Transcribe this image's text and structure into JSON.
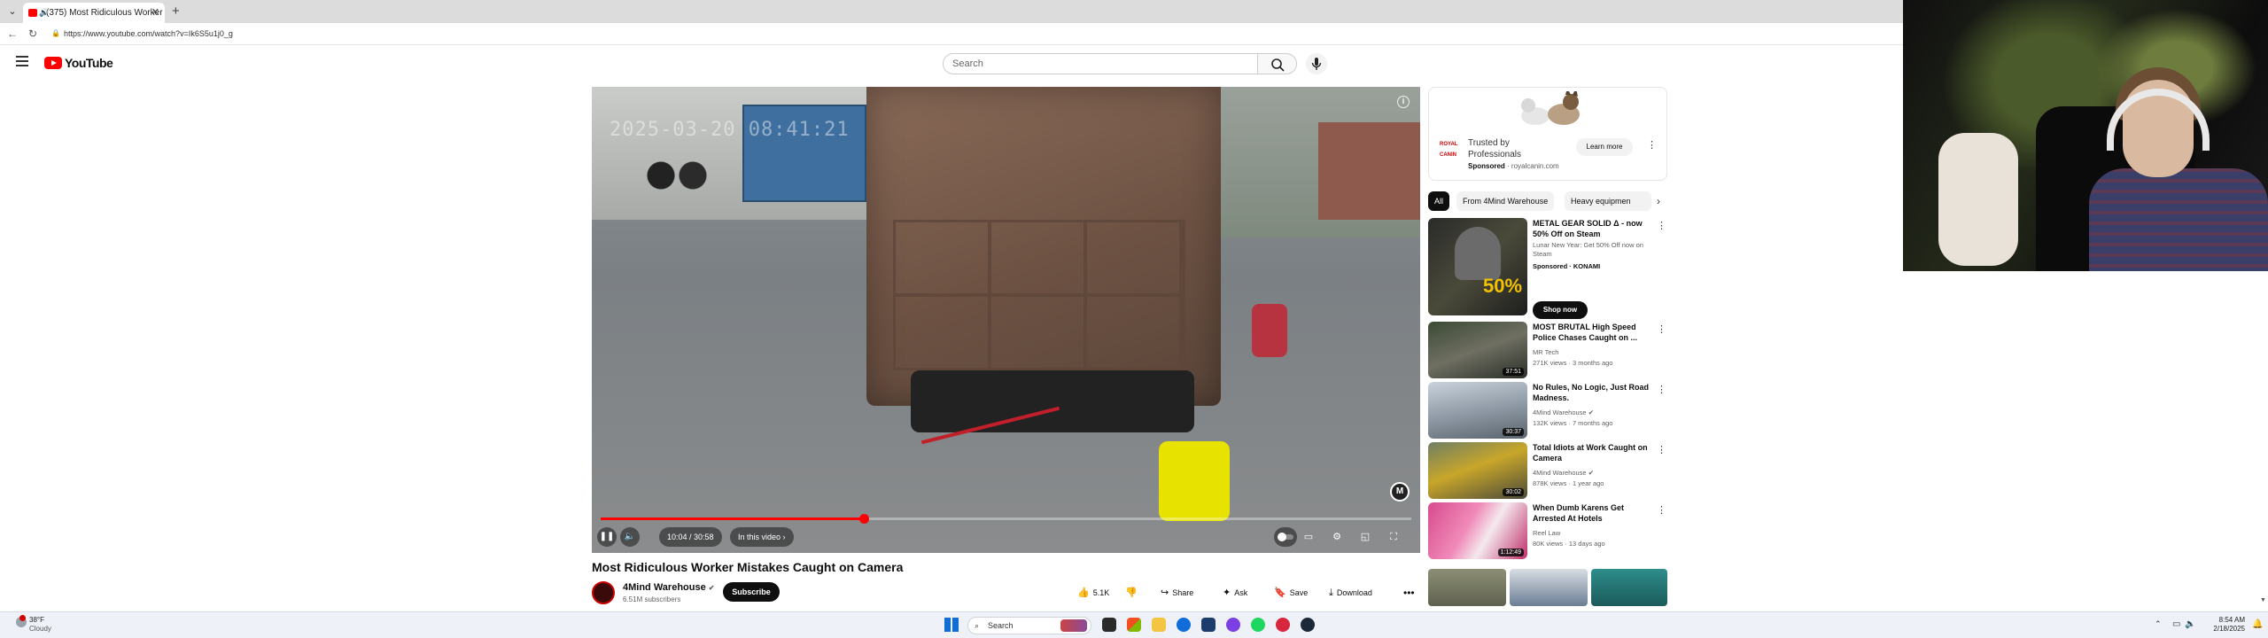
{
  "browser": {
    "tab_title": "(375) Most Ridiculous Worker",
    "new_tab_symbol": "+",
    "url": "https://www.youtube.com/watch?v=Ik6S5u1j0_g"
  },
  "youtube": {
    "logo_text": "YouTube",
    "search_placeholder": "Search"
  },
  "player": {
    "timestamp_overlay": "2025-03-20 08:41:21",
    "time_display": "10:04 / 30:58",
    "chapter_pill": "In this video",
    "progress_fraction": 0.325,
    "brand_mark": "M"
  },
  "video": {
    "title": "Most Ridiculous Worker Mistakes Caught on Camera",
    "channel_name": "4Mind Warehouse",
    "subscribers": "6.51M subscribers",
    "subscribe_label": "Subscribe",
    "likes": "5.1K",
    "share_label": "Share",
    "ask_label": "Ask",
    "save_label": "Save",
    "download_label": "Download"
  },
  "ad": {
    "headline": "Trusted by Professionals",
    "sponsored": "Sponsored",
    "domain": "· royalcanin.com",
    "cta": "Learn more",
    "logo_text": "ROYAL CANIN"
  },
  "chips": [
    "All",
    "From 4Mind Warehouse",
    "Heavy equipmen"
  ],
  "recommendations": [
    {
      "title": "METAL GEAR SOLID Δ - now 50% Off on Steam",
      "line1": "Lunar New Year: Get 50% Off now on Steam",
      "line2": "Sponsored · KONAMI",
      "cta": "Shop now",
      "duration": ""
    },
    {
      "title": "MOST BRUTAL High Speed Police Chases Caught on ...",
      "line1": "MR Tech",
      "line2": "271K views · 3 months ago",
      "duration": "37:51"
    },
    {
      "title": "No Rules, No Logic, Just Road Madness.",
      "line1": "4Mind Warehouse",
      "line2": "132K views · 7 months ago",
      "duration": "30:37"
    },
    {
      "title": "Total Idiots at Work Caught on Camera",
      "line1": "4Mind Warehouse",
      "line2": "878K views · 1 year ago",
      "duration": "30:02"
    },
    {
      "title": "When Dumb Karens Get Arrested At Hotels",
      "line1": "Reel Law",
      "line2": "80K views · 13 days ago",
      "duration": "1:12:49"
    }
  ],
  "taskbar": {
    "temperature": "38°F",
    "condition": "Cloudy",
    "search_label": "Search",
    "time": "8:54 AM",
    "date": "2/18/2025"
  },
  "colors": {
    "youtube_red": "#ff0000",
    "text_primary": "#0f0f0f",
    "text_secondary": "#606060",
    "windows_blue": "#0f6cd9"
  }
}
